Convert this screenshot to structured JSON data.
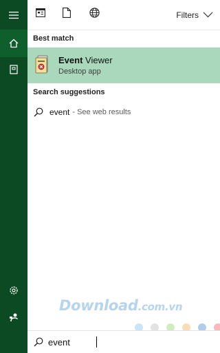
{
  "top_bar": {
    "filters_label": "Filters",
    "icons": [
      "apps-icon",
      "document-icon",
      "web-globe-icon"
    ]
  },
  "left_rail": {
    "icons": [
      "hamburger-icon",
      "home-icon",
      "notebook-icon",
      "settings-icon",
      "feedback-icon"
    ]
  },
  "best_match": {
    "section_label": "Best match",
    "title_highlight": "Event",
    "title_rest": " Viewer",
    "subtitle": "Desktop app"
  },
  "suggestions": {
    "section_label": "Search suggestions",
    "items": [
      {
        "term": "event",
        "hint": "- See web results"
      }
    ]
  },
  "search": {
    "value": "event",
    "placeholder": ""
  },
  "watermark": {
    "brand": "Download",
    "tld": ".com.vn",
    "dot_colors": [
      "#9fd0f0",
      "#cccccc",
      "#a8e08a",
      "#f7c07b",
      "#6fa5d8",
      "#f08080"
    ]
  },
  "colors": {
    "rail": "#0b4a22",
    "rail_active": "#0f5f2c",
    "highlight": "#a9d8bd"
  }
}
